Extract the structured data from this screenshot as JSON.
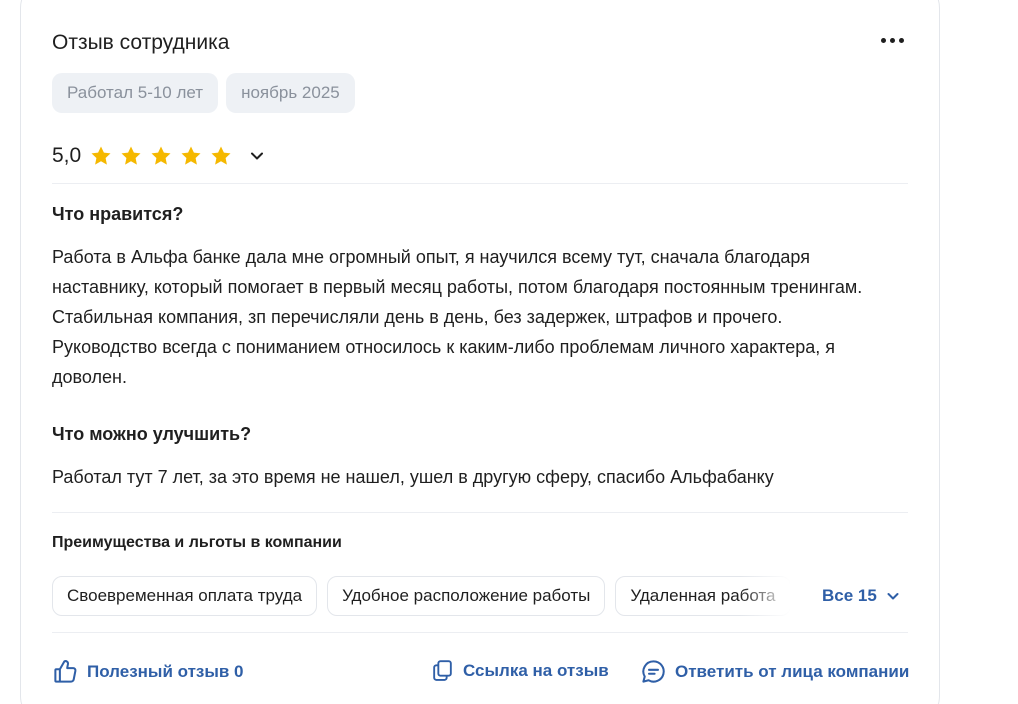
{
  "header": {
    "title": "Отзыв сотрудника",
    "menu_icon": "more-horizontal-icon"
  },
  "tags": [
    "Работал 5-10 лет",
    "ноябрь 2025"
  ],
  "rating": {
    "value": "5,0",
    "stars": 5,
    "star_color": "#f5b800"
  },
  "likes": {
    "heading": "Что нравится?",
    "text": "Работа в Альфа банке дала мне огромный опыт, я научился всему тут, сначала благодаря наставнику, который помогает в первый месяц работы, потом благодаря постоянным тренингам. Стабильная компания, зп перечисляли день в день, без задержек, штрафов и прочего. Руководство всегда с пониманием относилось к каким-либо проблемам личного характера, я доволен."
  },
  "improve": {
    "heading": "Что можно улучшить?",
    "text": "Работал тут 7 лет, за это время не нашел, ушел в другую сферу, спасибо Альфабанку"
  },
  "benefits": {
    "heading": "Преимущества и льготы в компании",
    "items": [
      "Своевременная оплата труда",
      "Удобное расположение работы",
      "Удаленная работа"
    ],
    "all_label": "Все 15"
  },
  "actions": {
    "helpful": "Полезный отзыв 0",
    "link": "Ссылка на отзыв",
    "reply": "Ответить от лица компании"
  },
  "colors": {
    "accent": "#2f5fa7",
    "chip_bg": "#eef1f5",
    "chip_text": "#8a919c"
  }
}
